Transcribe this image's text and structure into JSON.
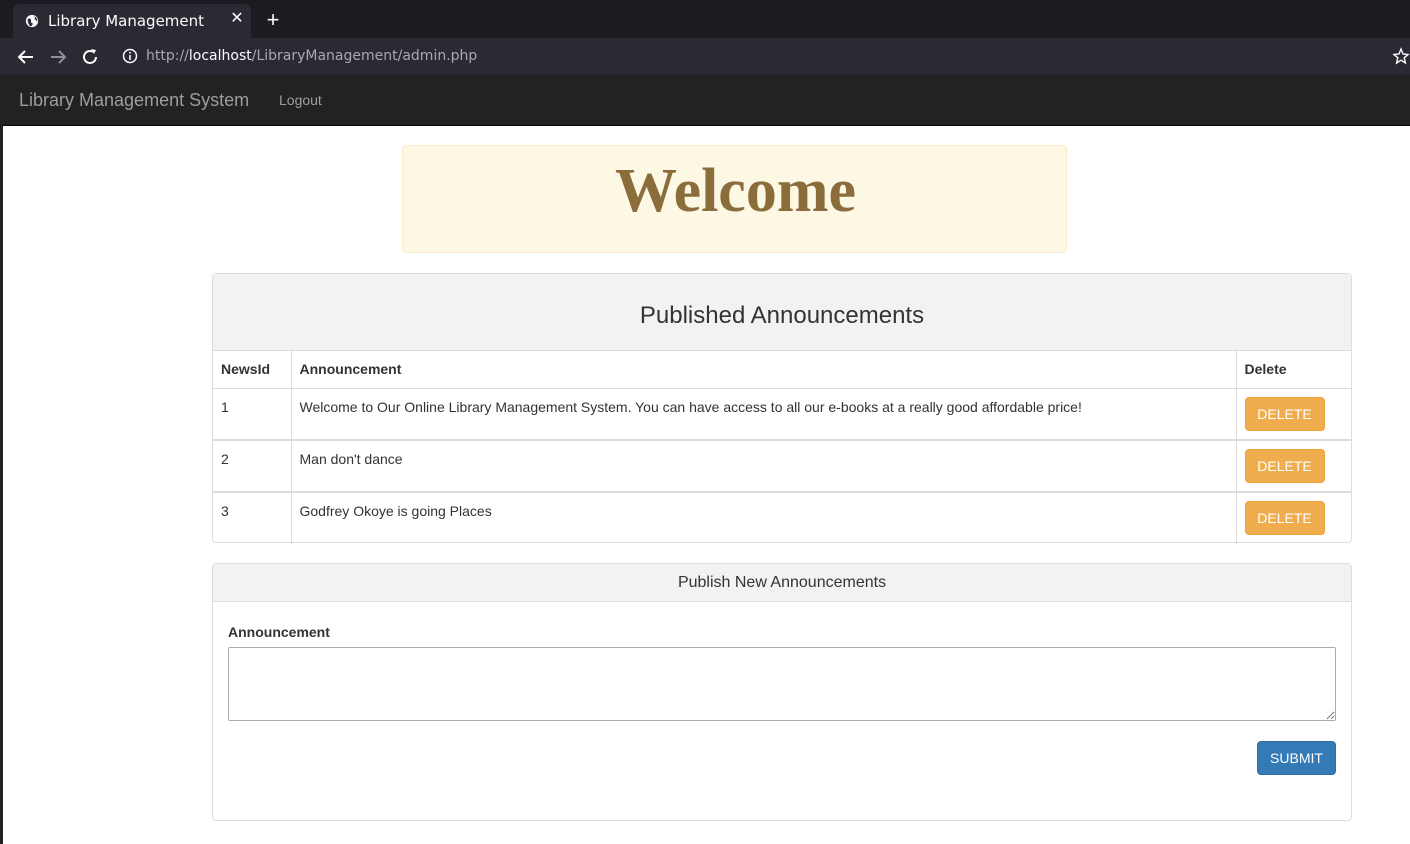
{
  "browser": {
    "tab_title": "Library Management",
    "url_scheme": "http://",
    "url_host": "localhost",
    "url_path": "/LibraryManagement/admin.php"
  },
  "navbar": {
    "brand": "Library Management System",
    "logout": "Logout"
  },
  "welcome": {
    "heading": "Welcome"
  },
  "published": {
    "title": "Published Announcements",
    "columns": [
      "NewsId",
      "Announcement",
      "Delete"
    ],
    "rows": [
      {
        "id": "1",
        "text": "Welcome to Our Online Library Management System. You can have access to all our e-books at a really good affordable price!",
        "action": "DELETE"
      },
      {
        "id": "2",
        "text": "Man don't dance",
        "action": "DELETE"
      },
      {
        "id": "3",
        "text": "Godfrey Okoye is going Places",
        "action": "DELETE"
      }
    ]
  },
  "publish_new": {
    "title": "Publish New Announcements",
    "field_label": "Announcement",
    "field_value": "",
    "submit_label": "SUBMIT"
  },
  "colors": {
    "navbar_bg": "#222222",
    "welcome_bg": "#fcf8e3",
    "welcome_text": "#8a6d3b",
    "delete_button": "#f0ad4e",
    "submit_button": "#337ab7"
  }
}
